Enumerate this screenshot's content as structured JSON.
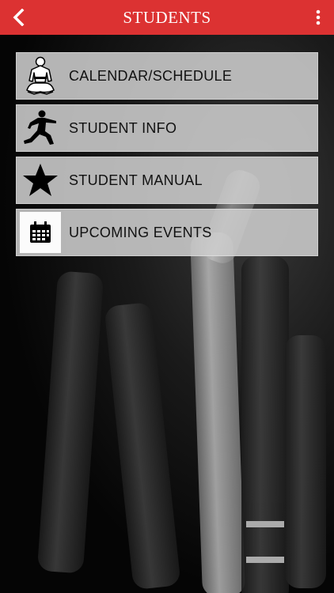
{
  "header": {
    "title": "STUDENTS",
    "back_icon": "chevron-left-icon",
    "more_icon": "more-vertical-icon",
    "color": "#dc3232"
  },
  "menu": {
    "items": [
      {
        "label": "CALENDAR/SCHEDULE",
        "icon": "kneeling-karateka-icon"
      },
      {
        "label": "STUDENT INFO",
        "icon": "karate-stance-icon"
      },
      {
        "label": "STUDENT MANUAL",
        "icon": "star-icon"
      },
      {
        "label": "UPCOMING EVENTS",
        "icon": "calendar-icon"
      }
    ]
  },
  "background": {
    "subject": "black belts photo"
  }
}
